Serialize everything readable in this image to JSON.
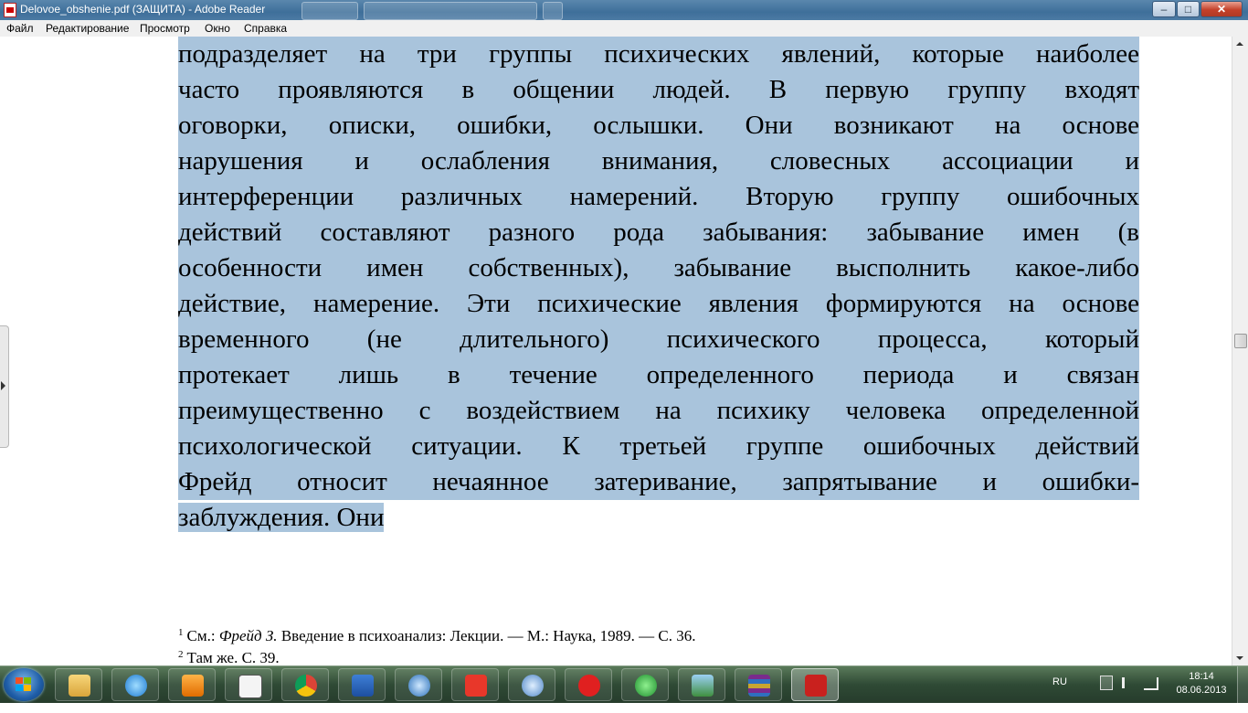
{
  "window": {
    "title": "Delovoe_obshenie.pdf (ЗАЩИТА) - Adobe Reader",
    "buttons": {
      "minimize": "–",
      "maximize": "□",
      "close": "✕"
    }
  },
  "menu": {
    "file": "Файл",
    "edit": "Редактирование",
    "view": "Просмотр",
    "window": "Окно",
    "help": "Справка"
  },
  "document": {
    "lines": [
      "подразделяет на три группы психических явлений, которые наиболее",
      "часто проявляются в общении людей. В первую группу входят",
      "оговорки, описки, ошибки, ослышки. Они возникают на основе",
      "нарушения и ослабления внимания, словесных ассоциации и",
      "интерференции различных намерений. Вторую группу ошибочных",
      "действий составляют разного рода забывания: забывание имен (в",
      "особенности имен собственных), забывание высполнить какое-либо",
      "действие, намерение. Эти психические явления формируются на основе",
      "временного (не длительного) психического процесса, который",
      "протекает лишь в течение определенного периода и связан",
      "преимущественно с воздействием на психику человека определенной",
      "психологической ситуации. К третьей группе ошибочных действий",
      "Фрейд относит нечаянное затеривание, запрятывание и ошибки-",
      "заблуждения. Они"
    ],
    "footnotes": [
      {
        "num": "1",
        "prefix": "См.: ",
        "author": "Фрейд З.",
        "text": " Введение в психоанализ: Лекции. — М.: Наука, 1989. — С. 36."
      },
      {
        "num": "2",
        "prefix": "Там же. С. 39.",
        "author": "",
        "text": ""
      }
    ],
    "selection_color": "#a9c4dc"
  },
  "taskbar": {
    "icons": [
      "windows-explorer-icon",
      "internet-explorer-icon",
      "media-player-icon",
      "solitaire-icon",
      "chrome-icon",
      "word-icon",
      "email-client-icon",
      "yandex-icon",
      "sound-app-icon",
      "yandex-browser-icon",
      "network-app-icon",
      "image-viewer-icon",
      "winrar-icon",
      "adobe-reader-icon"
    ],
    "language": "RU",
    "time": "18:14",
    "date": "08.06.2013"
  }
}
